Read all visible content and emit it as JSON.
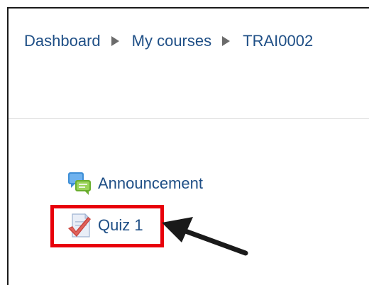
{
  "breadcrumb": {
    "items": [
      {
        "label": "Dashboard"
      },
      {
        "label": "My courses"
      },
      {
        "label": "TRAI0002"
      }
    ]
  },
  "activities": {
    "announcement": {
      "label": "Announcement",
      "icon": "forum-icon"
    },
    "quiz": {
      "label": "Quiz 1",
      "icon": "quiz-icon"
    }
  },
  "annotations": {
    "highlight_color": "#e8000b",
    "arrow_color": "#1a1a1a"
  }
}
